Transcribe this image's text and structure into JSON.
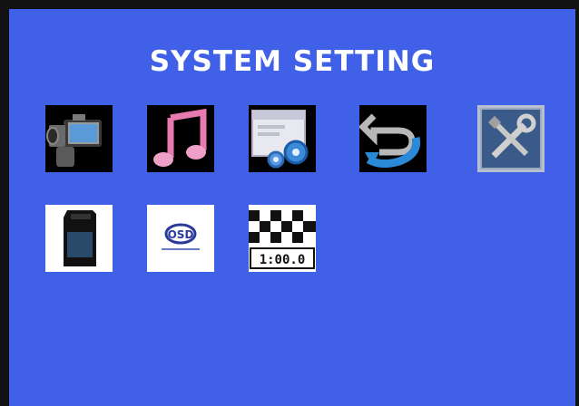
{
  "screen": {
    "title": "SYSTEM SETTING",
    "background_color": "#4060e8",
    "border_color": "#111111"
  },
  "menu": {
    "items": [
      {
        "id": "video",
        "icon": "camcorder-icon"
      },
      {
        "id": "music",
        "icon": "music-note-icon"
      },
      {
        "id": "settings",
        "icon": "window-gears-icon"
      },
      {
        "id": "back",
        "icon": "return-arrow-icon"
      },
      {
        "id": "tools",
        "icon": "wrench-screwdriver-icon"
      },
      {
        "id": "memory-card",
        "icon": "sd-card-icon"
      },
      {
        "id": "osd",
        "icon": "osd-icon"
      },
      {
        "id": "timer",
        "icon": "checkered-flag-timer-icon"
      }
    ],
    "osd_label": "OSD",
    "timer_label": "1:00.0"
  }
}
